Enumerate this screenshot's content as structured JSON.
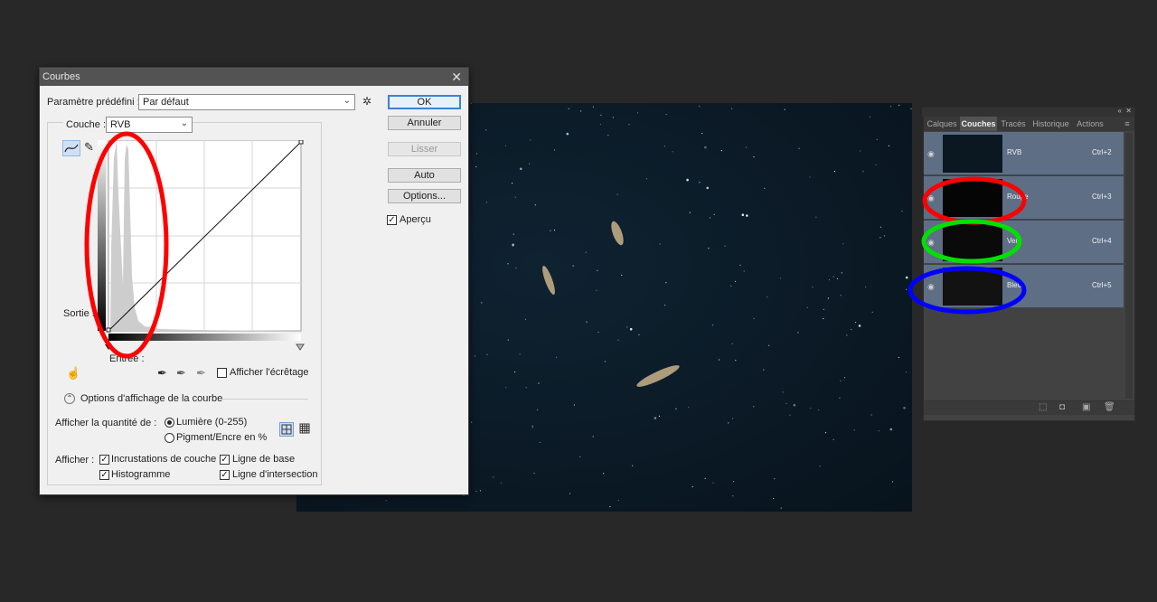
{
  "dialog": {
    "title": "Courbes",
    "preset_label": "Paramètre prédéfini :",
    "preset_value": "Par défaut",
    "channel_label": "Couche :",
    "channel_value": "RVB",
    "output_label": "Sortie :",
    "input_label": "Entrée :",
    "buttons": {
      "ok": "OK",
      "cancel": "Annuler",
      "smooth": "Lisser",
      "auto": "Auto",
      "options": "Options..."
    },
    "preview_label": "Aperçu",
    "show_clipping_label": "Afficher l'écrêtage",
    "display_options_label": "Options d'affichage de la courbe",
    "show_amount_label": "Afficher la quantité de :",
    "light_label": "Lumière (0-255)",
    "pigment_label": "Pigment/Encre en %",
    "show_label": "Afficher :",
    "overlay_label": "Incrustations de couche",
    "baseline_label": "Ligne de base",
    "histogram_label": "Histogramme",
    "intersection_label": "Ligne d'intersection",
    "checks": {
      "preview": true,
      "clipping": false,
      "overlay": true,
      "baseline": true,
      "histogram": true,
      "intersection": true
    },
    "amount_selected": "light"
  },
  "panel": {
    "tabs": [
      "Calques",
      "Couches",
      "Tracés",
      "Historique",
      "Actions"
    ],
    "active_tab": "Couches",
    "channels": [
      {
        "name": "RVB",
        "shortcut": "Ctrl+2"
      },
      {
        "name": "Rouge",
        "shortcut": "Ctrl+3"
      },
      {
        "name": "Vert",
        "shortcut": "Ctrl+4"
      },
      {
        "name": "Bleu",
        "shortcut": "Ctrl+5"
      }
    ]
  },
  "annotations": {
    "colors": [
      "#ff0000",
      "#ff0000",
      "#00e000",
      "#0000ff"
    ]
  }
}
